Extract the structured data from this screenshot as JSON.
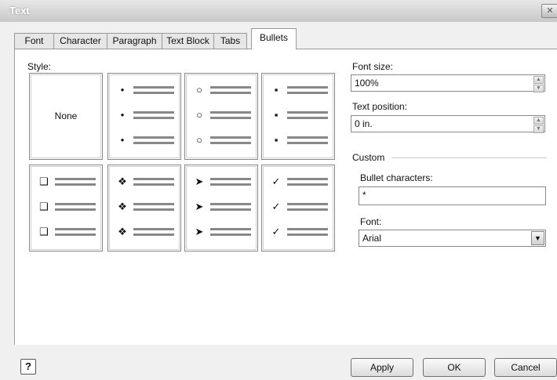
{
  "window": {
    "title": "Text",
    "close_glyph": "✕"
  },
  "tabs": [
    {
      "label": "Font"
    },
    {
      "label": "Character"
    },
    {
      "label": "Paragraph"
    },
    {
      "label": "Text Block"
    },
    {
      "label": "Tabs"
    },
    {
      "label": "Bullets",
      "active": true
    }
  ],
  "style": {
    "label": "Style:",
    "none_label": "None",
    "bullets": [
      "•",
      "○",
      "▪",
      "❑",
      "❖",
      "➤",
      "✓"
    ]
  },
  "font_size": {
    "label": "Font size:",
    "value": "100%"
  },
  "text_position": {
    "label": "Text position:",
    "value": "0 in."
  },
  "custom": {
    "label": "Custom",
    "bullet_chars_label": "Bullet characters:",
    "bullet_chars_value": "*",
    "font_label": "Font:",
    "font_value": "Arial"
  },
  "buttons": {
    "help": "?",
    "apply": "Apply",
    "ok": "OK",
    "cancel": "Cancel"
  },
  "icons": {
    "spin_up": "▲",
    "spin_down": "▼",
    "dropdown": "▼"
  }
}
